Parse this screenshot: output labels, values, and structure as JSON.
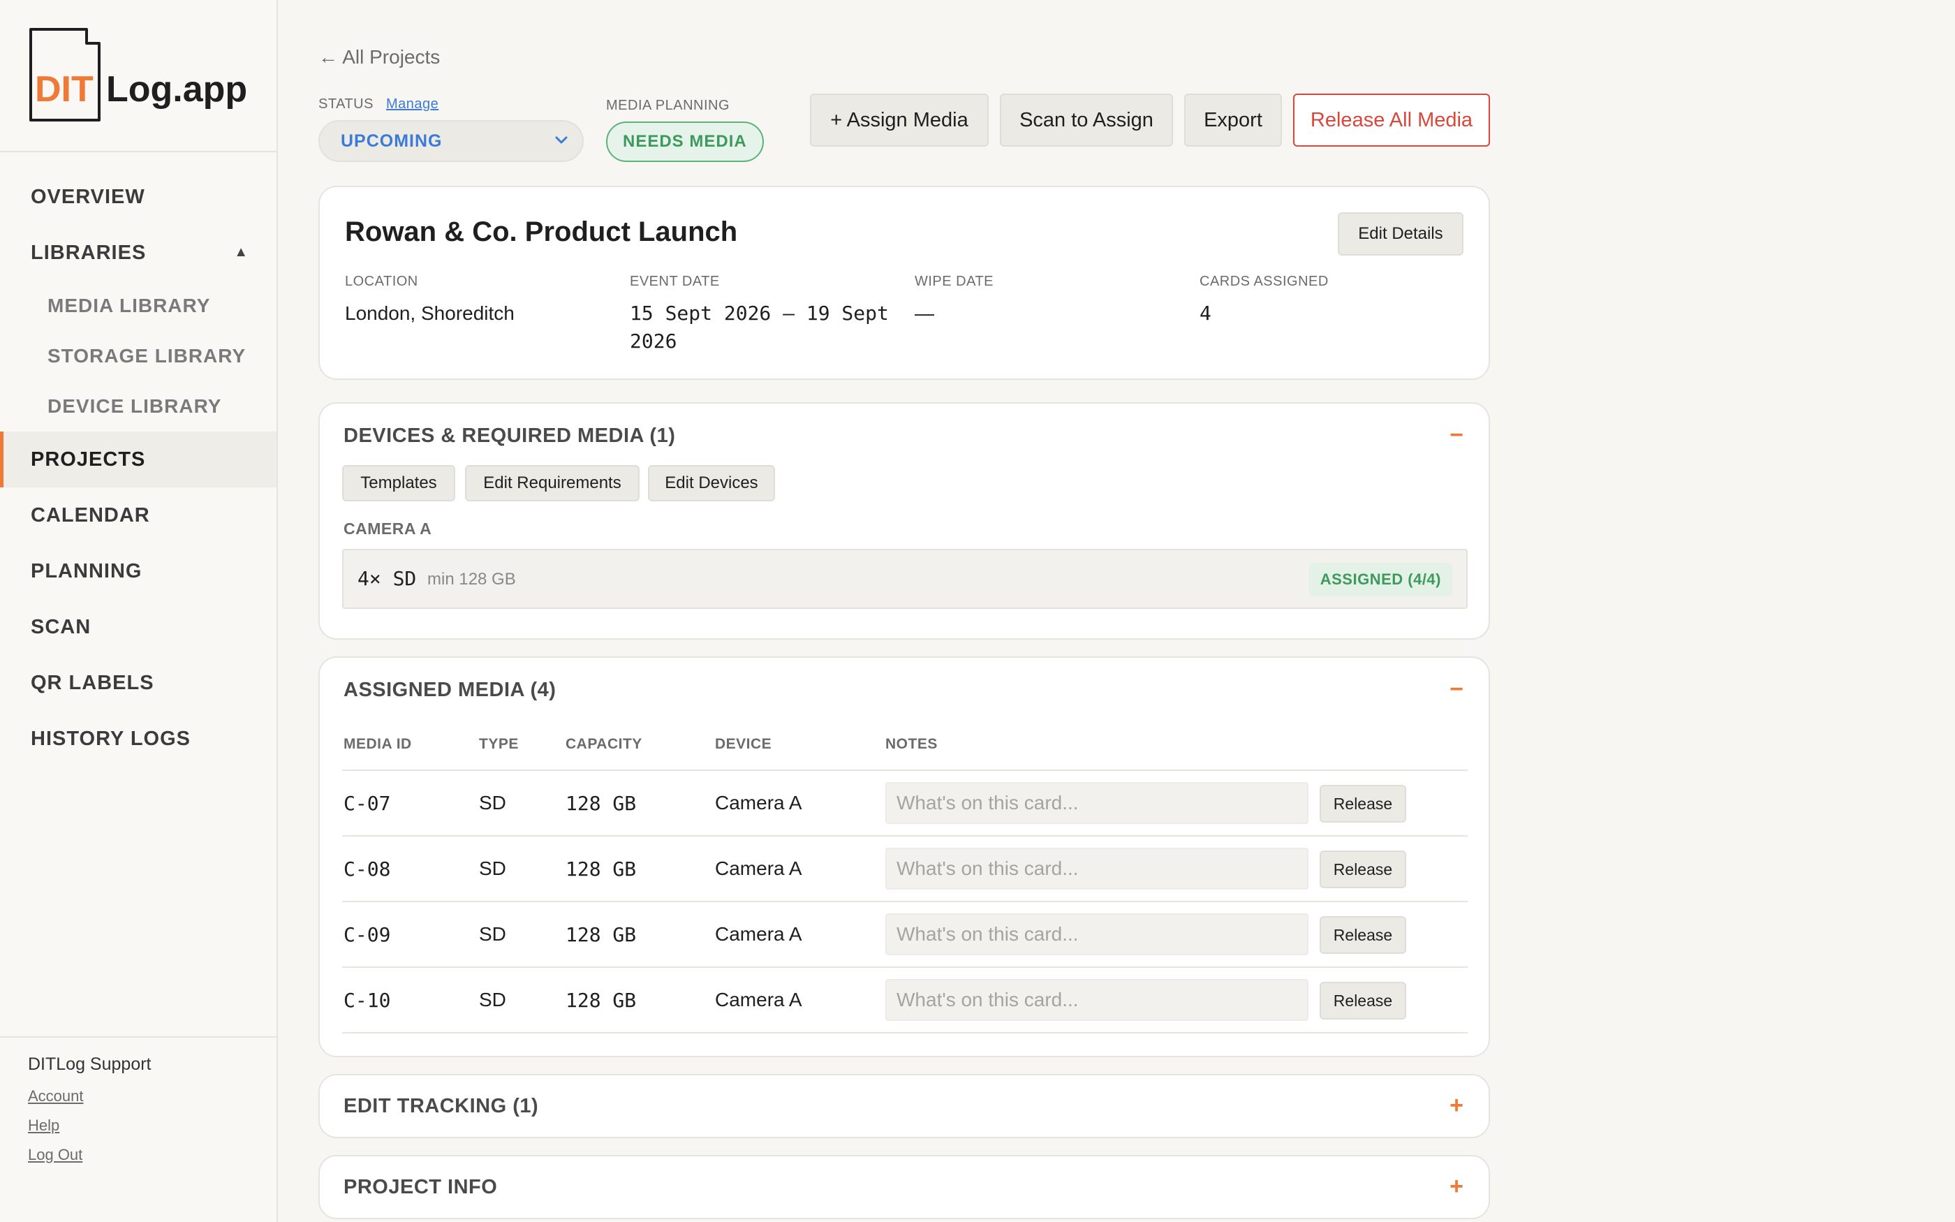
{
  "app": {
    "logo_dit": "DIT",
    "logo_rest": "Log.app",
    "brand_color": "#f07a35"
  },
  "sidebar": {
    "items": [
      {
        "label": "OVERVIEW"
      },
      {
        "label": "LIBRARIES",
        "expanded": true,
        "caret": "▲"
      },
      {
        "label": "MEDIA LIBRARY",
        "sub": true
      },
      {
        "label": "STORAGE LIBRARY",
        "sub": true
      },
      {
        "label": "DEVICE LIBRARY",
        "sub": true
      },
      {
        "label": "PROJECTS",
        "active": true
      },
      {
        "label": "CALENDAR"
      },
      {
        "label": "PLANNING"
      },
      {
        "label": "SCAN"
      },
      {
        "label": "QR LABELS"
      },
      {
        "label": "HISTORY LOGS"
      }
    ],
    "footer": {
      "title": "DITLog Support",
      "account": "Account",
      "help": "Help",
      "logout": "Log Out"
    }
  },
  "header": {
    "back": "← All Projects",
    "status_label": "STATUS",
    "manage": "Manage",
    "status_value": "UPCOMING",
    "media_planning_label": "MEDIA PLANNING",
    "media_planning_value": "NEEDS MEDIA",
    "assign_media": "+ Assign Media",
    "scan_to_assign": "Scan to Assign",
    "export": "Export",
    "release_all": "Release All Media"
  },
  "project": {
    "title": "Rowan & Co. Product Launch",
    "edit_details": "Edit Details",
    "location_label": "LOCATION",
    "location": "London, Shoreditch",
    "event_date_label": "EVENT DATE",
    "event_date": "15 Sept 2026 – 19 Sept 2026",
    "wipe_date_label": "WIPE DATE",
    "wipe_date": "—",
    "cards_assigned_label": "CARDS ASSIGNED",
    "cards_assigned": "4"
  },
  "devices": {
    "title": "DEVICES & REQUIRED MEDIA (1)",
    "toggle": "−",
    "templates": "Templates",
    "edit_requirements": "Edit Requirements",
    "edit_devices": "Edit Devices",
    "camera_label": "CAMERA A",
    "requirement": {
      "count": "4× SD",
      "min": "min 128 GB",
      "badge": "ASSIGNED (4/4)"
    }
  },
  "assigned": {
    "title": "ASSIGNED MEDIA (4)",
    "toggle": "−",
    "columns": {
      "media_id": "MEDIA ID",
      "type": "TYPE",
      "capacity": "CAPACITY",
      "device": "DEVICE",
      "notes": "NOTES"
    },
    "note_placeholder": "What's on this card...",
    "release_label": "Release",
    "rows": [
      {
        "id": "C-07",
        "type": "SD",
        "capacity": "128 GB",
        "device": "Camera A"
      },
      {
        "id": "C-08",
        "type": "SD",
        "capacity": "128 GB",
        "device": "Camera A"
      },
      {
        "id": "C-09",
        "type": "SD",
        "capacity": "128 GB",
        "device": "Camera A"
      },
      {
        "id": "C-10",
        "type": "SD",
        "capacity": "128 GB",
        "device": "Camera A"
      }
    ]
  },
  "edit_tracking": {
    "title": "EDIT TRACKING (1)",
    "toggle": "+"
  },
  "project_info": {
    "title": "PROJECT INFO",
    "toggle": "+"
  }
}
